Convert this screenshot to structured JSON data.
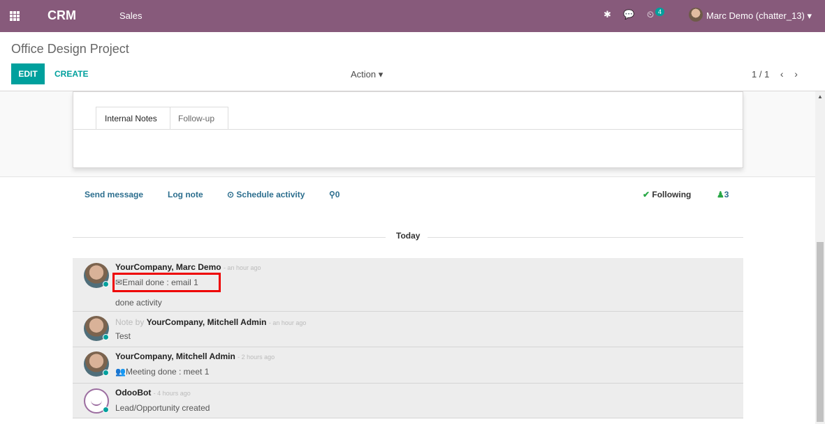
{
  "navbar": {
    "app": "CRM",
    "menu": "Sales",
    "activity_count": "4",
    "user": "Marc Demo (chatter_13) ▾"
  },
  "control_panel": {
    "title": "Office Design Project",
    "edit": "EDIT",
    "create": "CREATE",
    "action": "Action ▾",
    "pager": "1 / 1"
  },
  "tabs": [
    {
      "label": "Internal Notes"
    },
    {
      "label": "Follow-up"
    }
  ],
  "chatter": {
    "send_message": "Send message",
    "log_note": "Log note",
    "schedule_activity": "Schedule activity",
    "attachments": "0",
    "following": "Following",
    "followers": "3",
    "today": "Today"
  },
  "messages": [
    {
      "author": "YourCompany, Marc Demo",
      "time": "- an hour ago",
      "line1": "Email done : email 1",
      "line2": "done activity"
    },
    {
      "prefix": "Note by ",
      "author": "YourCompany, Mitchell Admin",
      "time": "- an hour ago",
      "line1": "Test"
    },
    {
      "author": "YourCompany, Mitchell Admin",
      "time": "- 2 hours ago",
      "line1": "Meeting done : meet 1"
    },
    {
      "author": "OdooBot",
      "time": "- 4 hours ago",
      "line1": "Lead/Opportunity created"
    }
  ],
  "colors": {
    "navbar": "#875a7b",
    "accent": "#00a09d",
    "link": "#2c6e8e"
  }
}
